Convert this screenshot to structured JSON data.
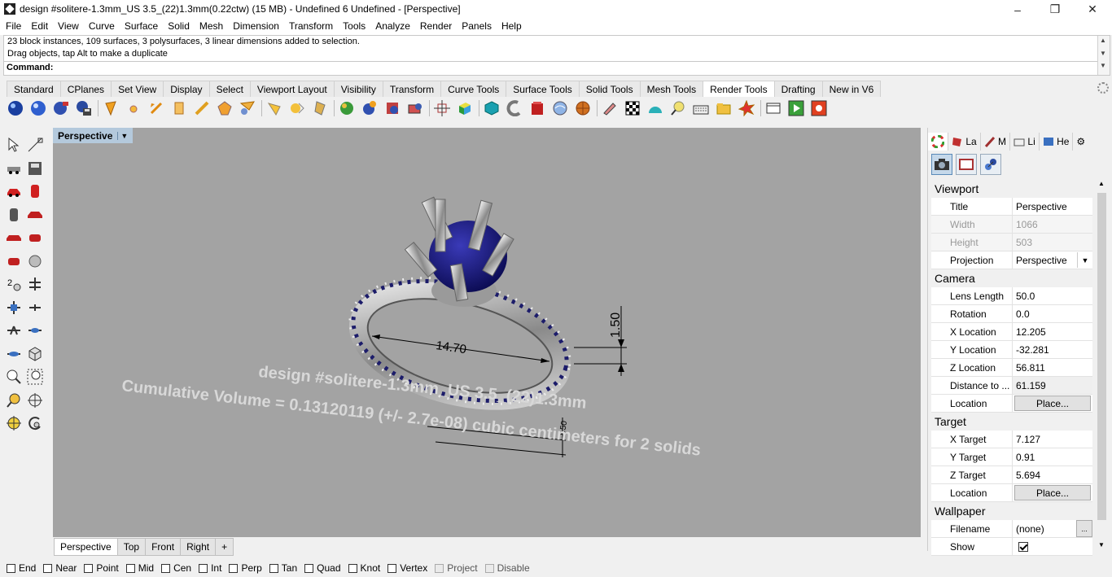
{
  "window": {
    "title": "design #solitere-1.3mm_US 3.5_(22)1.3mm(0.22ctw) (15 MB) - Undefined 6 Undefined - [Perspective]",
    "minimize": "–",
    "maximize": "❐",
    "close": "✕"
  },
  "menu": [
    "File",
    "Edit",
    "View",
    "Curve",
    "Surface",
    "Solid",
    "Mesh",
    "Dimension",
    "Transform",
    "Tools",
    "Analyze",
    "Render",
    "Panels",
    "Help"
  ],
  "command": {
    "history": [
      "23 block instances, 109 surfaces, 3 polysurfaces, 3 linear dimensions added to selection.",
      "Drag objects, tap Alt to make a duplicate"
    ],
    "label": "Command:",
    "value": ""
  },
  "toolbar_tabs": [
    "Standard",
    "CPlanes",
    "Set View",
    "Display",
    "Select",
    "Viewport Layout",
    "Visibility",
    "Transform",
    "Curve Tools",
    "Surface Tools",
    "Solid Tools",
    "Mesh Tools",
    "Render Tools",
    "Drafting",
    "New in V6"
  ],
  "toolbar_tabs_active": "Render Tools",
  "viewport": {
    "label": "Perspective",
    "dim_width": "14.70",
    "dim_height": "1.50",
    "dim_small": "1.50",
    "annotation_line1": "design #solitere-1.3mm_US 3.5_(22)1.3mm",
    "annotation_line2": "Cumulative Volume = 0.13120119 (+/- 2.7e-08) cubic centimeters for 2 solids"
  },
  "viewport_tabs": [
    "Perspective",
    "Top",
    "Front",
    "Right"
  ],
  "viewport_tab_add": "+",
  "osnaps": [
    {
      "label": "End",
      "checked": false,
      "enabled": true
    },
    {
      "label": "Near",
      "checked": false,
      "enabled": true
    },
    {
      "label": "Point",
      "checked": false,
      "enabled": true
    },
    {
      "label": "Mid",
      "checked": false,
      "enabled": true
    },
    {
      "label": "Cen",
      "checked": false,
      "enabled": true
    },
    {
      "label": "Int",
      "checked": false,
      "enabled": true
    },
    {
      "label": "Perp",
      "checked": false,
      "enabled": true
    },
    {
      "label": "Tan",
      "checked": false,
      "enabled": true
    },
    {
      "label": "Quad",
      "checked": false,
      "enabled": true
    },
    {
      "label": "Knot",
      "checked": false,
      "enabled": true
    },
    {
      "label": "Vertex",
      "checked": false,
      "enabled": true
    },
    {
      "label": "Project",
      "checked": false,
      "enabled": false
    },
    {
      "label": "Disable",
      "checked": false,
      "enabled": false
    }
  ],
  "panel": {
    "tabs": [
      "",
      "La",
      "M",
      "Li",
      "He"
    ],
    "viewport": {
      "heading": "Viewport",
      "title_label": "Title",
      "title_value": "Perspective",
      "width_label": "Width",
      "width_value": "1066",
      "height_label": "Height",
      "height_value": "503",
      "projection_label": "Projection",
      "projection_value": "Perspective"
    },
    "camera": {
      "heading": "Camera",
      "lens_label": "Lens Length",
      "lens_value": "50.0",
      "rotation_label": "Rotation",
      "rotation_value": "0.0",
      "x_label": "X Location",
      "x_value": "12.205",
      "y_label": "Y Location",
      "y_value": "-32.281",
      "z_label": "Z Location",
      "z_value": "56.811",
      "dist_label": "Distance to ...",
      "dist_value": "61.159",
      "loc_label": "Location",
      "loc_button": "Place..."
    },
    "target": {
      "heading": "Target",
      "x_label": "X Target",
      "x_value": "7.127",
      "y_label": "Y Target",
      "y_value": "0.91",
      "z_label": "Z Target",
      "z_value": "5.694",
      "loc_label": "Location",
      "loc_button": "Place..."
    },
    "wallpaper": {
      "heading": "Wallpaper",
      "file_label": "Filename",
      "file_value": "(none)",
      "file_button": "...",
      "show_label": "Show",
      "show_checked": true
    }
  }
}
